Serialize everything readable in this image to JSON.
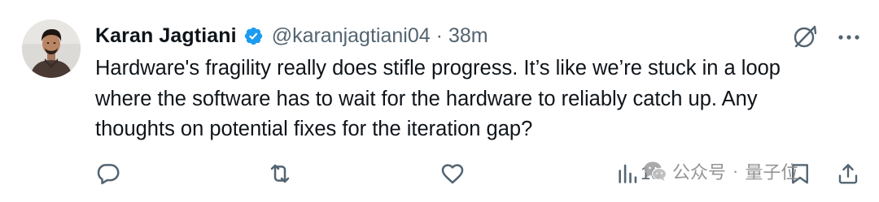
{
  "tweet": {
    "author": {
      "display_name": "Karan Jagtiani",
      "handle": "@karanjagtiani04",
      "verified": true,
      "time_ago": "38m",
      "separator": "·"
    },
    "text_lines": [
      "Hardware's fragility really does stifle progress. It’s like we’re stuck in a loop",
      "where the software has to wait for the hardware to reliably catch up. Any",
      "thoughts on potential fixes for the iteration gap?"
    ],
    "actions": {
      "views_count": "16"
    },
    "icons": {
      "verified": "verified-badge-icon",
      "grok": "grok-icon",
      "more": "more-dots-icon",
      "reply": "reply-icon",
      "retweet": "retweet-icon",
      "like": "heart-icon",
      "views": "analytics-icon",
      "bookmark": "bookmark-icon",
      "share": "share-icon"
    },
    "colors": {
      "text": "#0f1419",
      "secondary": "#536471",
      "verified": "#1d9bf0",
      "background": "#ffffff"
    }
  },
  "watermark": {
    "channel": "公众号",
    "separator": "·",
    "name": "量子位"
  }
}
